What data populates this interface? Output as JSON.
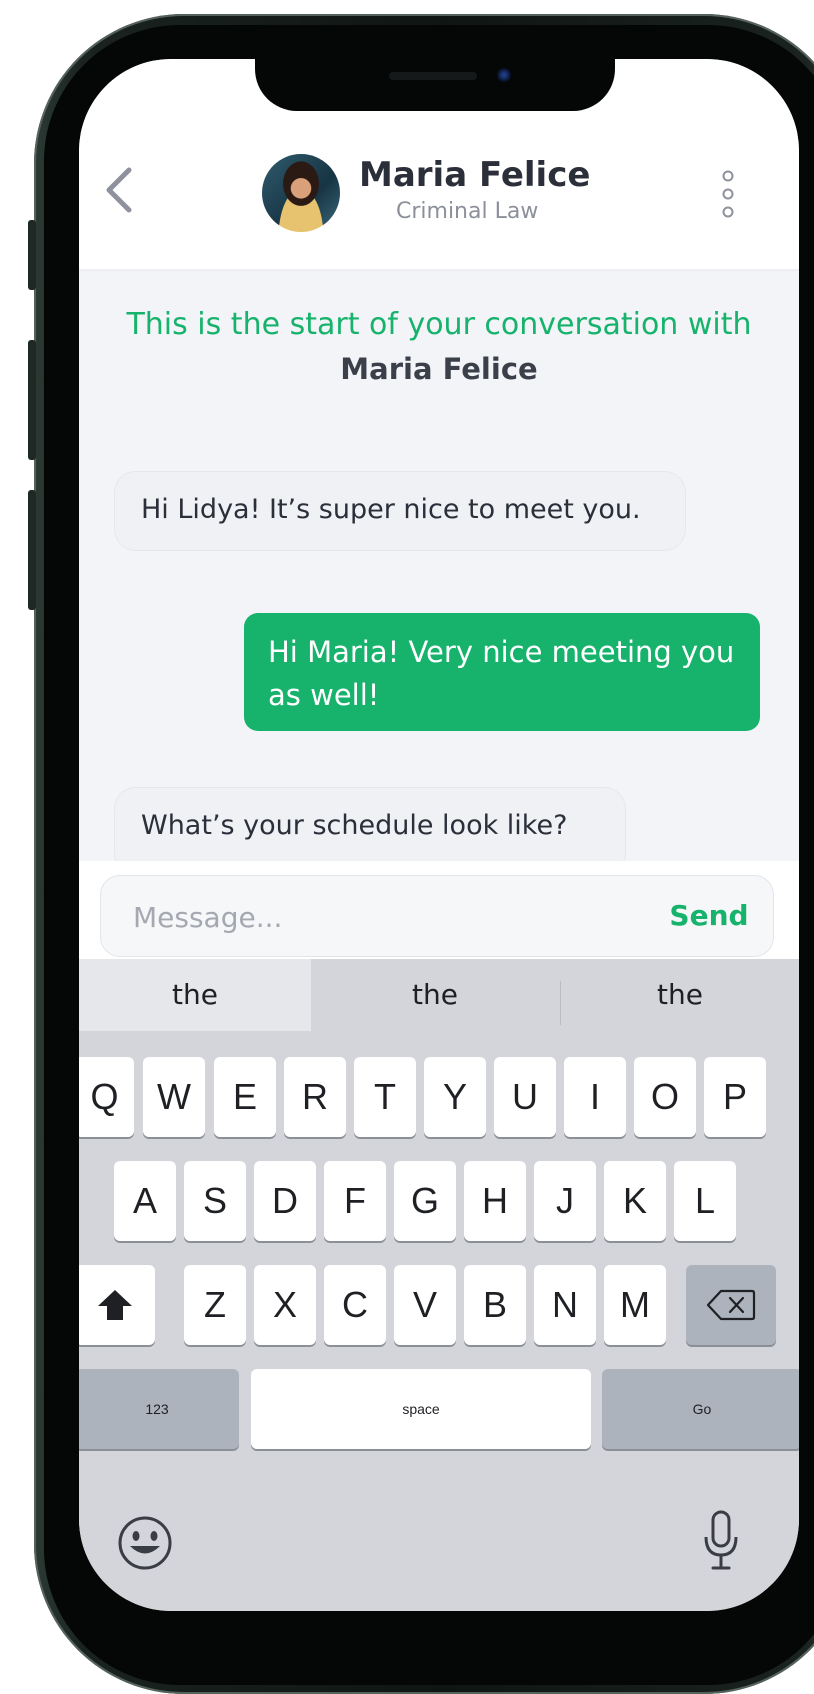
{
  "header": {
    "contact_name": "Maria Felice",
    "contact_subtitle": "Criminal Law"
  },
  "conversation": {
    "intro_text": "This is the start of your conversation with",
    "intro_name": "Maria Felice",
    "messages": [
      {
        "direction": "incoming",
        "text": "Hi Lidya! It’s super nice to meet you."
      },
      {
        "direction": "outgoing",
        "text": "Hi Maria! Very nice meeting you as well!"
      },
      {
        "direction": "incoming",
        "text": "What’s your schedule look like?"
      }
    ]
  },
  "composer": {
    "placeholder": "Message...",
    "value": "",
    "send_label": "Send"
  },
  "keyboard": {
    "suggestions": [
      "the",
      "the",
      "the"
    ],
    "row1": [
      "Q",
      "W",
      "E",
      "R",
      "T",
      "Y",
      "U",
      "I",
      "O",
      "P"
    ],
    "row2": [
      "A",
      "S",
      "D",
      "F",
      "G",
      "H",
      "J",
      "K",
      "L"
    ],
    "row3": [
      "Z",
      "X",
      "C",
      "V",
      "B",
      "N",
      "M"
    ],
    "numbers_label": "123",
    "space_label": "space",
    "go_label": "Go"
  },
  "colors": {
    "accent": "#17b26c",
    "background": "#f2f4f7",
    "keyboard": "#d3d5da"
  },
  "icons": {
    "back": "chevron-left-icon",
    "more": "vertical-dots-icon",
    "shift": "shift-arrow-icon",
    "backspace": "backspace-icon",
    "emoji": "smiley-icon",
    "mic": "microphone-icon"
  }
}
